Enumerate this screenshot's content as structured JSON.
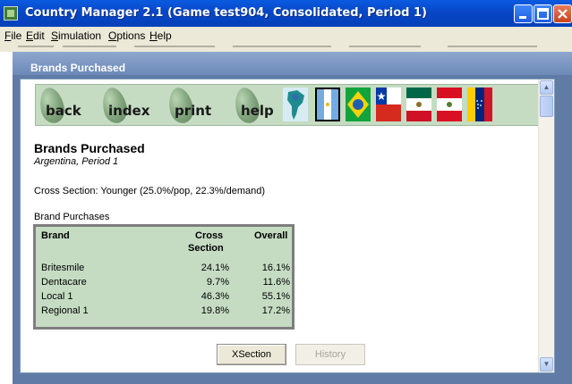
{
  "window": {
    "title": "Country Manager 2.1 (Game test904, Consolidated, Period 1)",
    "controls": [
      "minimize-icon",
      "maximize-icon",
      "close-icon"
    ]
  },
  "menu": [
    {
      "label": "File"
    },
    {
      "label": "Edit"
    },
    {
      "label": "Simulation"
    },
    {
      "label": "Options"
    },
    {
      "label": "Help"
    }
  ],
  "panel": {
    "title": "Brands Purchased"
  },
  "nav": [
    {
      "label": "back"
    },
    {
      "label": "index"
    },
    {
      "label": "print"
    },
    {
      "label": "help"
    }
  ],
  "flags": [
    "south-america-map-icon",
    "argentina-flag-icon",
    "brazil-flag-icon",
    "chile-flag-icon",
    "mexico-flag-icon",
    "peru-flag-icon",
    "venezuela-flag-icon"
  ],
  "report": {
    "heading": "Brands Purchased",
    "subheading": "Argentina, Period 1",
    "cross_section": "Cross Section: Younger (25.0%/pop, 22.3%/demand)",
    "table_caption": "Brand Purchases",
    "columns": {
      "brand": "Brand",
      "cross_line1": "Cross",
      "cross_line2": "Section",
      "overall": "Overall"
    },
    "rows": [
      {
        "brand": "Britesmile",
        "cross": "24.1%",
        "overall": "16.1%"
      },
      {
        "brand": "Dentacare",
        "cross": "9.7%",
        "overall": "11.6%"
      },
      {
        "brand": "Local 1",
        "cross": "46.3%",
        "overall": "55.1%"
      },
      {
        "brand": "Regional 1",
        "cross": "19.8%",
        "overall": "17.2%"
      }
    ]
  },
  "buttons": {
    "xsection": "XSection",
    "history": "History"
  },
  "colors": {
    "title_bar": "#0a5be0",
    "panel_header": "#6c89b8",
    "nav_bg": "#c5dcc3",
    "table_bg": "#c5dcc3"
  }
}
